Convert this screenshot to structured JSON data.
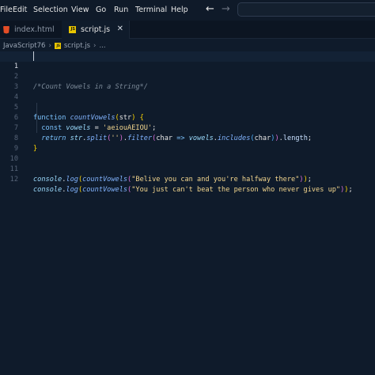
{
  "menu": {
    "file": "File",
    "edit": "Edit",
    "selection": "Selection",
    "view": "View",
    "go": "Go",
    "run": "Run",
    "terminal": "Terminal",
    "help": "Help"
  },
  "nav": {
    "back": "←",
    "forward": "→"
  },
  "tabs": [
    {
      "label": "index.html",
      "icon": "html-file-icon",
      "active": false
    },
    {
      "label": "script.js",
      "icon": "js-file-icon",
      "active": true
    }
  ],
  "tab_close": "✕",
  "breadcrumb": {
    "folder": "JavaScript76",
    "file": "script.js",
    "symbol": "..."
  },
  "editor": {
    "current_line": 1,
    "line_numbers": [
      "1",
      "2",
      "3",
      "4",
      "5",
      "6",
      "7",
      "8",
      "9",
      "10",
      "11",
      "12"
    ],
    "comment": "/*Count Vowels in a String*/",
    "l5": {
      "kw": "function",
      "name": "countVowels",
      "param": "str"
    },
    "l6": {
      "kw": "const",
      "var": "vowels",
      "op": " = ",
      "str": "'aeiouAEIOU'"
    },
    "l7": {
      "kw": "return",
      "obj": "str",
      "m1": "split",
      "arg1": "''",
      "m2": "filter",
      "arrow_param": "char",
      "arrow": " => ",
      "var": "vowels",
      "m3": "includes",
      "arg2": "char",
      "prop": "length"
    },
    "l11": {
      "obj": "console",
      "m": "log",
      "fn": "countVowels",
      "str": "\"Belive you can and you're halfway there\""
    },
    "l12": {
      "obj": "console",
      "m": "log",
      "fn": "countVowels",
      "str": "\"You just can't beat the person who never gives up\""
    }
  },
  "colors": {
    "background": "#0f1b2b",
    "keyword": "#7dc4ff",
    "string": "#f3d68e",
    "comment": "#7c8a99"
  }
}
